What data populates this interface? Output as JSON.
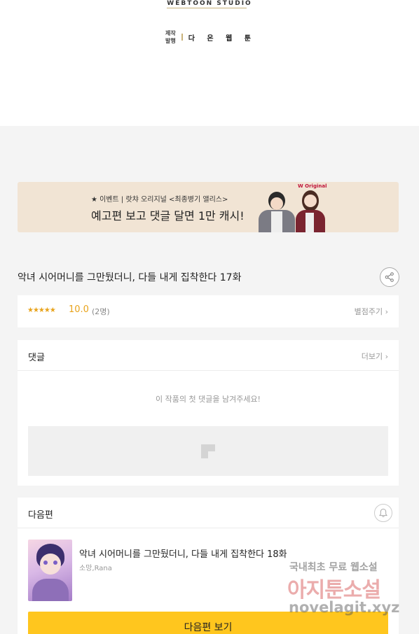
{
  "header": {
    "studio": "WEBTOON STUDIO",
    "credit_labels": [
      "제작",
      "발행"
    ],
    "credit_name": "다 온 웹 툰"
  },
  "banner": {
    "small_text": "★ 이벤트 | 랏챠 오리지널 <최종병기 앨리스>",
    "main_text": "예고편 보고 댓글 달면 1만 캐시!",
    "logo": "W Original"
  },
  "episode": {
    "title": "악녀 시어머니를 그만뒀더니, 다들 내게 집착한다 17화"
  },
  "rating": {
    "stars": "★★★★★",
    "score": "10.0",
    "votes": "(2명)",
    "rate_button": "별점주기 ›"
  },
  "comments": {
    "title": "댓글",
    "more": "더보기 ›",
    "empty_text": "이 작품의 첫 댓글을 남겨주세요!"
  },
  "next_episode": {
    "section_title": "다음편",
    "title": "악녀 시어머니를 그만뒀더니, 다들 내게 집착한다 18화",
    "author": "소망,Rana",
    "button": "다음편 보기"
  },
  "watermark": {
    "line1": "국내최초 무료 웹소설",
    "line2": "아지툰소설",
    "line3": "novelagit.xyz"
  },
  "colors": {
    "accent": "#ffc61e",
    "star": "#e8a31b",
    "banner_bg": "#f1e4d4"
  }
}
